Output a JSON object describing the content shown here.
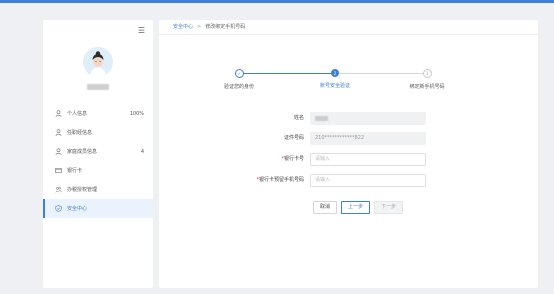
{
  "sidebar": {
    "items": [
      {
        "label": "个人信息",
        "badge": "100%",
        "icon": "user-icon"
      },
      {
        "label": "任职经信息",
        "badge": "",
        "icon": "user-icon"
      },
      {
        "label": "家庭成员信息",
        "badge": "4",
        "icon": "user-icon"
      },
      {
        "label": "银行卡",
        "badge": "",
        "icon": "card-icon"
      },
      {
        "label": "办税授权管理",
        "badge": "",
        "icon": "users-icon"
      },
      {
        "label": "安全中心",
        "badge": "",
        "icon": "shield-icon",
        "active": true
      }
    ]
  },
  "breadcrumb": {
    "root": "安全中心",
    "separator": ">",
    "current": "修改绑定手机号码"
  },
  "steps": [
    {
      "index": "1",
      "label": "验证您的身份",
      "state": "done"
    },
    {
      "index": "2",
      "label": "账号安全验证",
      "state": "current"
    },
    {
      "index": "3",
      "label": "绑定新手机号码",
      "state": "pending"
    }
  ],
  "form": {
    "name_label": "姓名",
    "id_label": "证件号码",
    "id_value": "210************822",
    "bank_card_label": "银行卡号",
    "bank_card_placeholder": "请输入",
    "bank_phone_label": "银行卡预留手机号码",
    "bank_phone_placeholder": "请输入",
    "required_mark": "*"
  },
  "buttons": {
    "cancel": "取消",
    "prev": "上一步",
    "next": "下一步"
  },
  "colors": {
    "accent": "#3f7fd8",
    "required": "#e2403a",
    "active_bg": "#eaf2fd"
  }
}
